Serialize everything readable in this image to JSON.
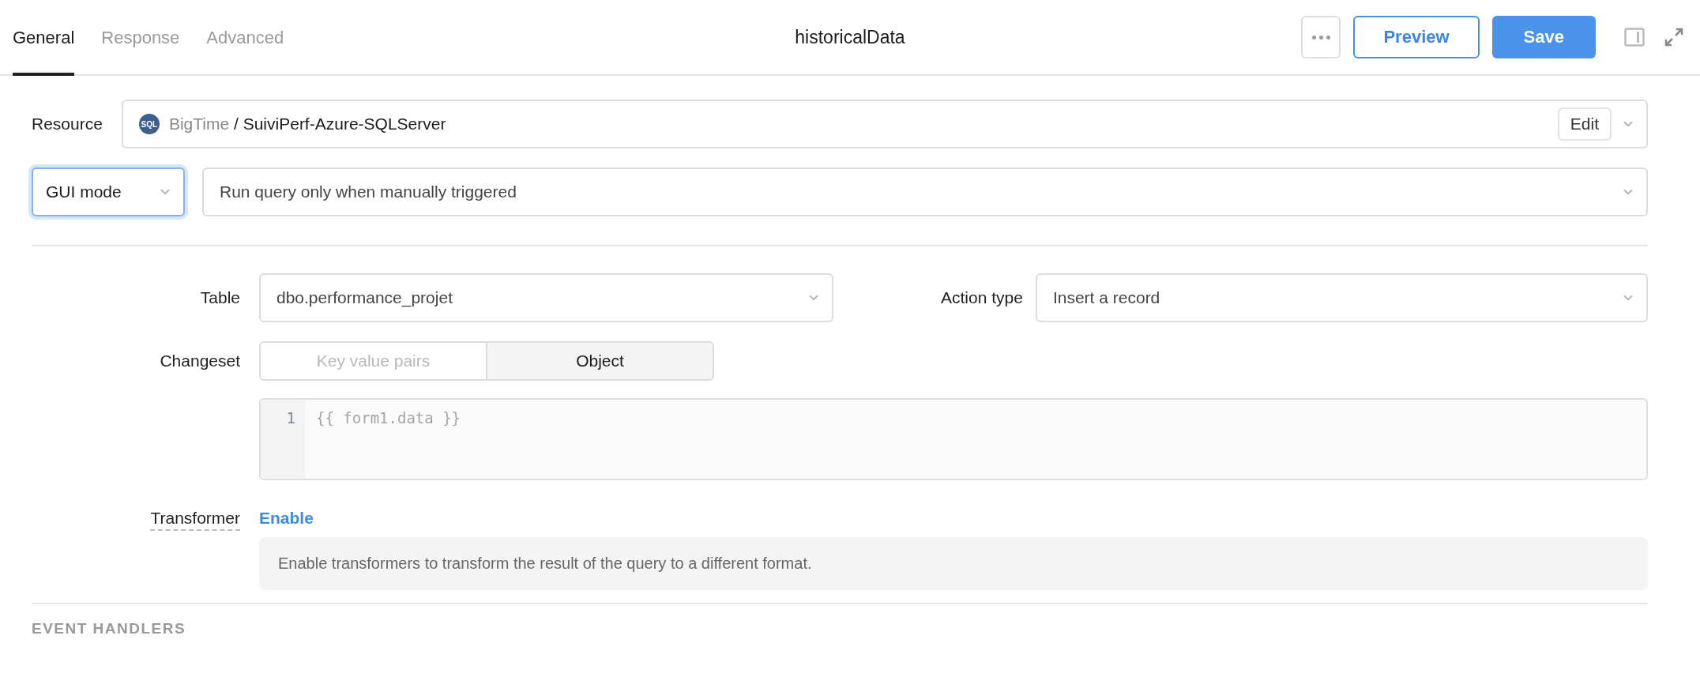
{
  "tabs": [
    {
      "label": "General",
      "selected": true
    },
    {
      "label": "Response",
      "selected": false
    },
    {
      "label": "Advanced",
      "selected": false
    }
  ],
  "title": "historicalData",
  "actions": {
    "preview": "Preview",
    "save": "Save"
  },
  "resource": {
    "label": "Resource",
    "icon_text": "SQL",
    "folder": "BigTime",
    "separator": "/",
    "name": "SuiviPerf-Azure-SQLServer",
    "edit": "Edit"
  },
  "mode": {
    "value": "GUI mode",
    "focused": true
  },
  "trigger": {
    "value": "Run query only when manually triggered"
  },
  "table": {
    "label": "Table",
    "value": "dbo.performance_projet"
  },
  "action_type": {
    "label": "Action type",
    "value": "Insert a record"
  },
  "changeset": {
    "label": "Changeset",
    "options": [
      {
        "label": "Key value pairs",
        "selected": false
      },
      {
        "label": "Object",
        "selected": true
      }
    ],
    "editor": {
      "lines": [
        {
          "number": "1",
          "code": "{{ form1.data }}"
        }
      ]
    }
  },
  "transformer": {
    "label": "Transformer",
    "action": "Enable",
    "hint": "Enable transformers to transform the result of the query to a different format."
  },
  "event_handlers": {
    "heading": "EVENT HANDLERS"
  }
}
